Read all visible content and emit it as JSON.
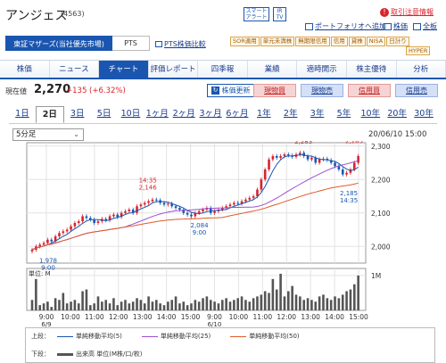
{
  "header": {
    "title": "アンジェス",
    "code": "(4563)",
    "smart_alert": "スマート\nアラート",
    "ir_tv": "IR\nTV",
    "tag_fuka": "取引注意情報",
    "portfolio_link": "ポートフォリオへ追加",
    "stock_report_link": "株価",
    "full_link": "全板"
  },
  "market": {
    "selected_tab": "東証マザーズ(当社優先市場)",
    "pts_tab": "PTS",
    "pts_compare_link": "PTS株価比較",
    "tags_row1": [
      "SOR適用",
      "単元未満株",
      "無期限信用",
      "信用",
      "貸株"
    ],
    "tags_row2": [
      "NISA",
      "日計り",
      "HYPER"
    ]
  },
  "nav": {
    "items": [
      "株価",
      "ニュース",
      "チャート",
      "評価レポート",
      "四季報",
      "業績",
      "適時開示",
      "株主優待",
      "分析"
    ],
    "active_index": 2
  },
  "quote": {
    "label": "現在値",
    "price": "2,270",
    "change": "+135 (+6.32%)",
    "update_button": "株価更新",
    "buy_button": "現物買",
    "sell_button": "現物売",
    "margin_buy_button": "信用買",
    "margin_sell_button": "信用売"
  },
  "periods": {
    "items": [
      "1日",
      "2日",
      "3日",
      "5日",
      "10日",
      "1ヶ月",
      "2ヶ月",
      "3ヶ月",
      "6ヶ月",
      "1年",
      "2年",
      "3年",
      "5年",
      "10年",
      "20年",
      "30年"
    ],
    "active_index": 1
  },
  "chart_controls": {
    "interval": "5分足",
    "datetime": "20/06/10 15:00"
  },
  "chart_data": {
    "type": "candlestick",
    "price_axis": {
      "min": 1950,
      "max": 2310,
      "ticks": [
        "2,300",
        "2,200",
        "2,100",
        "2,000"
      ],
      "tick_values": [
        2300,
        2200,
        2100,
        2000
      ]
    },
    "x_ticks": [
      "9:00",
      "10:00",
      "11:00",
      "12:00",
      "13:00",
      "14:00",
      "15:00",
      "9:00",
      "10:00",
      "11:00",
      "12:00",
      "13:00",
      "14:00",
      "15:00"
    ],
    "date_labels": [
      "6/9",
      "6/10"
    ],
    "volume_axis": {
      "unit_label": "単位: M",
      "tick": "1M"
    },
    "annotations": [
      {
        "time": "9:00",
        "value": "1,978",
        "kind": "low"
      },
      {
        "time": "14:35",
        "value": "2,146",
        "kind": "high"
      },
      {
        "time": "9:00",
        "value": "2,084",
        "kind": "low"
      },
      {
        "time": "13:30",
        "value": "2,283",
        "kind": "high"
      },
      {
        "time": "14:55",
        "value": "2,285",
        "kind": "high"
      },
      {
        "time": "14:35",
        "value": "2,185",
        "kind": "low"
      }
    ],
    "series_close": [
      1990,
      2000,
      2005,
      2010,
      2020,
      2015,
      2030,
      2040,
      2045,
      2050,
      2060,
      2070,
      2075,
      2090,
      2085,
      2080,
      2070,
      2075,
      2082,
      2078,
      2090,
      2095,
      2088,
      2100,
      2105,
      2110,
      2100,
      2120,
      2125,
      2130,
      2135,
      2140,
      2138,
      2130,
      2125,
      2128,
      2120,
      2115,
      2110,
      2100,
      2095,
      2090,
      2100,
      2105,
      2110,
      2115,
      2100,
      2105,
      2110,
      2115,
      2120,
      2125,
      2130,
      2128,
      2135,
      2140,
      2145,
      2150,
      2170,
      2200,
      2230,
      2260,
      2270,
      2265,
      2270,
      2275,
      2272,
      2268,
      2275,
      2280,
      2270,
      2260,
      2265,
      2250,
      2260,
      2262,
      2258,
      2250,
      2240,
      2230,
      2215,
      2220,
      2230,
      2250,
      2270
    ],
    "volumes": [
      0.3,
      0.9,
      0.15,
      0.2,
      0.25,
      0.1,
      0.35,
      0.3,
      0.5,
      0.2,
      0.25,
      0.3,
      0.2,
      0.55,
      0.6,
      0.15,
      0.2,
      0.4,
      0.25,
      0.3,
      0.2,
      0.35,
      0.15,
      0.25,
      0.3,
      0.2,
      0.25,
      0.35,
      0.3,
      0.2,
      0.4,
      0.25,
      0.3,
      0.2,
      0.15,
      0.25,
      0.3,
      0.4,
      0.2,
      0.25,
      0.15,
      0.2,
      0.3,
      0.25,
      0.35,
      0.4,
      0.3,
      0.25,
      0.2,
      0.3,
      0.35,
      0.25,
      0.3,
      0.35,
      0.4,
      0.3,
      0.25,
      0.35,
      0.4,
      0.45,
      0.55,
      0.5,
      0.9,
      0.6,
      1.05,
      0.4,
      0.55,
      0.7,
      0.45,
      0.4,
      0.3,
      0.35,
      0.3,
      0.25,
      0.4,
      0.45,
      0.35,
      0.3,
      0.4,
      0.35,
      0.45,
      0.55,
      0.6,
      0.75,
      1.0
    ],
    "ma5_color": "#1a56b0",
    "ma25_color": "#9b4fd0",
    "ma50_color": "#e05a2a",
    "up_color": "#d9232d",
    "down_color": "#1a56b0"
  },
  "legend": {
    "upper_label": "上段：",
    "lower_label": "下段：",
    "ma5": "単純移動平均(5)",
    "ma25": "単純移動平均(25)",
    "ma50": "単純移動平均(50)",
    "volume": "出来高 単位(M株/口/枚)"
  }
}
